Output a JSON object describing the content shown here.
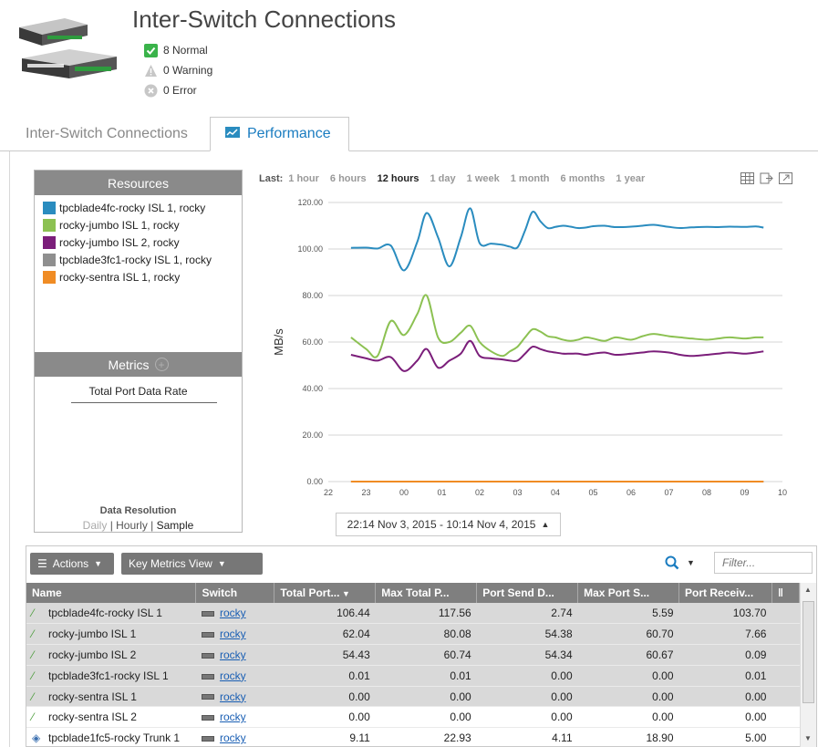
{
  "header": {
    "title": "Inter-Switch Connections",
    "status": [
      {
        "label": "8 Normal",
        "icon": "check-icon",
        "color": "#3ab34a"
      },
      {
        "label": "0 Warning",
        "icon": "warning-icon",
        "color": "#c7c7c7"
      },
      {
        "label": "0 Error",
        "icon": "error-icon",
        "color": "#c7c7c7"
      }
    ]
  },
  "tabs": [
    {
      "label": "Inter-Switch Connections",
      "active": false
    },
    {
      "label": "Performance",
      "active": true
    }
  ],
  "resources": {
    "title": "Resources",
    "items": [
      {
        "label": "tpcblade4fc-rocky ISL 1, rocky",
        "color": "#2a8cbf"
      },
      {
        "label": "rocky-jumbo ISL 1, rocky",
        "color": "#8cc152"
      },
      {
        "label": "rocky-jumbo ISL 2, rocky",
        "color": "#7b1e7a"
      },
      {
        "label": "tpcblade3fc1-rocky ISL 1, rocky",
        "color": "#8f8f8f"
      },
      {
        "label": "rocky-sentra ISL 1, rocky",
        "color": "#f08c24"
      }
    ]
  },
  "metrics": {
    "title": "Metrics",
    "items": [
      "Total Port Data Rate"
    ]
  },
  "data_resolution": {
    "title": "Data Resolution",
    "options": [
      "Daily",
      "Hourly",
      "Sample"
    ],
    "selected": "Sample"
  },
  "time_range": {
    "last_label": "Last:",
    "options": [
      "1 hour",
      "6 hours",
      "12 hours",
      "1 day",
      "1 week",
      "1 month",
      "6 months",
      "1 year"
    ],
    "selected": "12 hours",
    "date_range": "22:14 Nov 3, 2015 - 10:14 Nov 4, 2015"
  },
  "chart_data": {
    "type": "line",
    "ylabel": "MB/s",
    "xlabel": "",
    "ylim": [
      0,
      120
    ],
    "yticks": [
      "0.00",
      "20.00",
      "40.00",
      "60.00",
      "80.00",
      "100.00",
      "120.00"
    ],
    "xticks": [
      "22",
      "23",
      "00",
      "01",
      "02",
      "03",
      "04",
      "05",
      "06",
      "07",
      "08",
      "09",
      "10"
    ],
    "xlim": [
      22,
      34
    ],
    "grid": true,
    "x": [
      22.6,
      23.0,
      23.3,
      23.65,
      24.0,
      24.35,
      24.6,
      24.9,
      25.2,
      25.5,
      25.75,
      26.0,
      26.3,
      26.6,
      26.8,
      27.0,
      27.2,
      27.4,
      27.6,
      27.8,
      28.0,
      28.2,
      28.4,
      28.6,
      28.8,
      29.0,
      29.3,
      29.6,
      30.0,
      30.3,
      30.6,
      31.0,
      31.3,
      31.6,
      32.0,
      32.3,
      32.6,
      33.0,
      33.3,
      33.5
    ],
    "series": [
      {
        "name": "tpcblade4fc-rocky ISL 1, rocky",
        "color": "#2a8cbf",
        "values": [
          100.5,
          100.6,
          100.2,
          101.5,
          90.8,
          103,
          115.5,
          105,
          92.5,
          105,
          117.5,
          102.5,
          102.3,
          101.8,
          101,
          100.7,
          108,
          116,
          112,
          109,
          109.5,
          110,
          109.6,
          109,
          109.2,
          109.8,
          110,
          109.4,
          109.6,
          110,
          110.4,
          109.5,
          109,
          109.3,
          109.5,
          109.4,
          109.6,
          109.5,
          109.7,
          109.2
        ]
      },
      {
        "name": "rocky-jumbo ISL 1, rocky",
        "color": "#8cc152",
        "values": [
          62,
          57,
          54,
          69,
          63,
          72,
          80,
          62,
          60,
          64,
          67,
          60,
          56,
          54,
          56,
          58,
          62,
          65.5,
          64.5,
          62.5,
          62,
          61,
          60.5,
          61,
          62,
          61.5,
          60.5,
          62,
          61,
          62.5,
          63.5,
          62.5,
          62,
          61.5,
          61,
          61.5,
          62,
          61.5,
          62,
          62
        ]
      },
      {
        "name": "rocky-jumbo ISL 2, rocky",
        "color": "#7b1e7a",
        "values": [
          54.5,
          53,
          52,
          53.5,
          47.5,
          52,
          57,
          49,
          52,
          55,
          60.5,
          54,
          53,
          52.5,
          52,
          52,
          55,
          58,
          57,
          56,
          55.5,
          55,
          55,
          55,
          54.5,
          55,
          55.5,
          54.5,
          55,
          55.5,
          56,
          55.5,
          54.5,
          54,
          54.5,
          55,
          55.5,
          55,
          55.5,
          56
        ]
      },
      {
        "name": "tpcblade3fc1-rocky ISL 1, rocky",
        "color": "#8f8f8f",
        "values": [
          0.01,
          0.01,
          0.01,
          0.01,
          0.01,
          0.01,
          0.01,
          0.01,
          0.01,
          0.01,
          0.01,
          0.01,
          0.01,
          0.01,
          0.01,
          0.01,
          0.01,
          0.01,
          0.01,
          0.01,
          0.01,
          0.01,
          0.01,
          0.01,
          0.01,
          0.01,
          0.01,
          0.01,
          0.01,
          0.01,
          0.01,
          0.01,
          0.01,
          0.01,
          0.01,
          0.01,
          0.01,
          0.01,
          0.01,
          0.01
        ]
      },
      {
        "name": "rocky-sentra ISL 1, rocky",
        "color": "#f08c24",
        "values": [
          0,
          0,
          0,
          0,
          0,
          0,
          0,
          0,
          0,
          0,
          0,
          0,
          0,
          0,
          0,
          0,
          0,
          0,
          0,
          0,
          0,
          0,
          0,
          0,
          0,
          0,
          0,
          0,
          0,
          0,
          0,
          0,
          0,
          0,
          0,
          0,
          0,
          0,
          0,
          0
        ]
      }
    ]
  },
  "toolbar": {
    "actions_label": "Actions",
    "kmv_label": "Key Metrics View",
    "filter_placeholder": "Filter..."
  },
  "table": {
    "columns": [
      "Name",
      "Switch",
      "Total Port...",
      "Max Total P...",
      "Port Send D...",
      "Max Port S...",
      "Port Receiv..."
    ],
    "rows": [
      {
        "name": "tpcblade4fc-rocky ISL 1",
        "switch": "rocky",
        "vals": [
          "106.44",
          "117.56",
          "2.74",
          "5.59",
          "103.70"
        ],
        "selected": true,
        "icon": "isl-icon"
      },
      {
        "name": "rocky-jumbo ISL 1",
        "switch": "rocky",
        "vals": [
          "62.04",
          "80.08",
          "54.38",
          "60.70",
          "7.66"
        ],
        "selected": true,
        "icon": "isl-icon"
      },
      {
        "name": "rocky-jumbo ISL 2",
        "switch": "rocky",
        "vals": [
          "54.43",
          "60.74",
          "54.34",
          "60.67",
          "0.09"
        ],
        "selected": true,
        "icon": "isl-icon"
      },
      {
        "name": "tpcblade3fc1-rocky ISL 1",
        "switch": "rocky",
        "vals": [
          "0.01",
          "0.01",
          "0.00",
          "0.00",
          "0.01"
        ],
        "selected": true,
        "icon": "isl-icon"
      },
      {
        "name": "rocky-sentra ISL 1",
        "switch": "rocky",
        "vals": [
          "0.00",
          "0.00",
          "0.00",
          "0.00",
          "0.00"
        ],
        "selected": true,
        "icon": "isl-icon"
      },
      {
        "name": "rocky-sentra ISL 2",
        "switch": "rocky",
        "vals": [
          "0.00",
          "0.00",
          "0.00",
          "0.00",
          "0.00"
        ],
        "selected": false,
        "icon": "isl-icon"
      },
      {
        "name": "tpcblade1fc5-rocky Trunk 1",
        "switch": "rocky",
        "vals": [
          "9.11",
          "22.93",
          "4.11",
          "18.90",
          "5.00"
        ],
        "selected": false,
        "icon": "trunk-icon"
      }
    ]
  }
}
